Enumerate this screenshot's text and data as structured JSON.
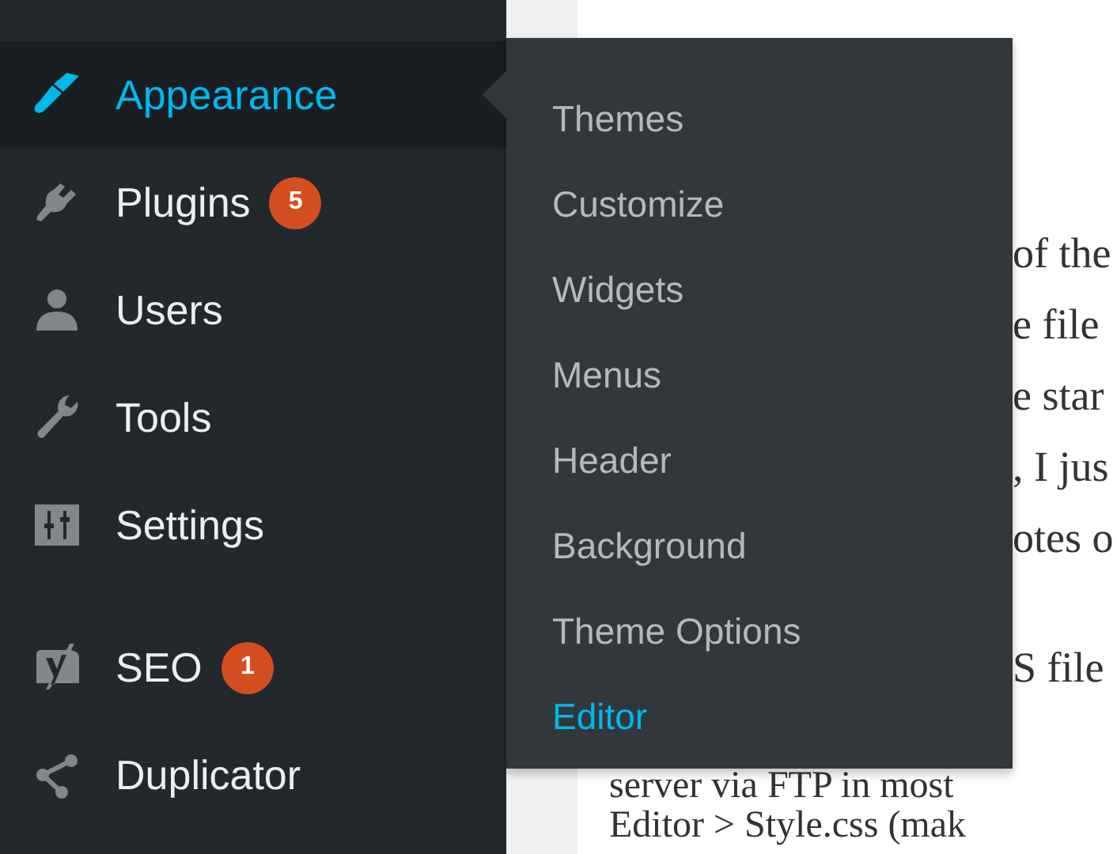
{
  "sidebar": {
    "groups": [
      {
        "items": [
          {
            "label": "Appearance",
            "selected": true
          },
          {
            "label": "Plugins",
            "selected": false,
            "badge": "5"
          },
          {
            "label": "Users",
            "selected": false
          },
          {
            "label": "Tools",
            "selected": false
          },
          {
            "label": "Settings",
            "selected": false
          }
        ]
      },
      {
        "items": [
          {
            "label": "SEO",
            "selected": false,
            "badge": "1"
          },
          {
            "label": "Duplicator",
            "selected": false
          }
        ]
      }
    ]
  },
  "submenu": {
    "items": [
      {
        "label": "Themes",
        "selected": false
      },
      {
        "label": "Customize",
        "selected": false
      },
      {
        "label": "Widgets",
        "selected": false
      },
      {
        "label": "Menus",
        "selected": false
      },
      {
        "label": "Header",
        "selected": false
      },
      {
        "label": "Background",
        "selected": false
      },
      {
        "label": "Theme Options",
        "selected": false
      },
      {
        "label": "Editor",
        "selected": true
      }
    ]
  },
  "content": {
    "beside_menu": [
      {
        "lines": [
          "of the",
          "e file",
          "e star",
          ", I jus",
          "otes o"
        ]
      },
      {
        "lines": [
          "S file"
        ]
      }
    ],
    "below_menu": {
      "lines": [
        "server via FTP in most",
        "Editor > Style.css (mak"
      ]
    }
  }
}
